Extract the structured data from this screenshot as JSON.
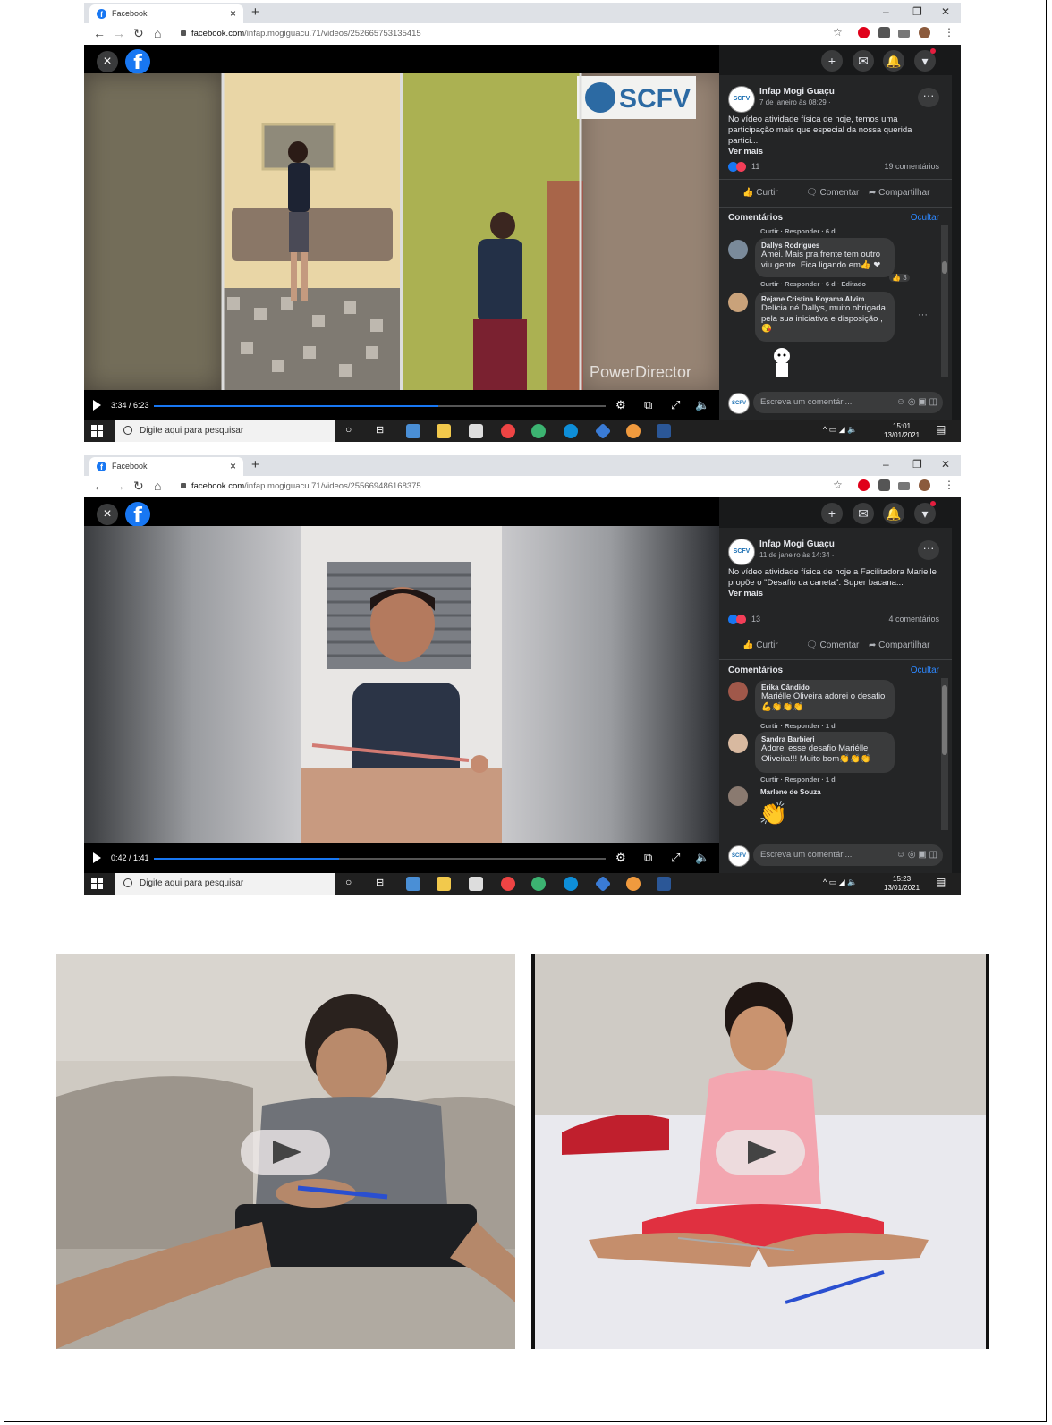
{
  "screens": [
    {
      "tab_title": "Facebook",
      "url_host": "facebook.com",
      "url_path": "/infap.mogiguacu.71/videos/252665753135415",
      "video_time": "3:34 / 6:23",
      "progress": 0.63,
      "post": {
        "page_name": "Infap Mogi Guaçu",
        "date": "7 de janeiro às 08:29 · ",
        "text": "No vídeo atividade física de hoje, temos uma participação mais que especial da nossa querida partici...",
        "see_more": "Ver mais",
        "reactions_count": "11",
        "comments_count": "19 comentários"
      },
      "actions": {
        "like": "Curtir",
        "comment": "Comentar",
        "share": "Compartilhar"
      },
      "comments_header": "Comentários",
      "hide_label": "Ocultar",
      "comments": [
        {
          "meta_only": "Curtir · Responder · 6 d"
        },
        {
          "author": "Dallys Rodrigues",
          "text": "Amei. Mais pra frente tem outro viu gente. Fica ligando em👍 ❤",
          "meta": "Curtir · Responder · 6 d · Editado",
          "badge": "3"
        },
        {
          "author": "Rejane Cristina Koyama Alvim",
          "text": "Delícia né Dallys, muito obrigada pela sua iniciativa e disposição , 😘",
          "meta": ""
        }
      ],
      "composer_placeholder": "Escreva um comentári...",
      "watermark_top": "SCFV",
      "watermark_bottom": "PowerDirector",
      "taskbar": {
        "search": "Digite aqui para pesquisar",
        "time": "15:01",
        "date": "13/01/2021"
      }
    },
    {
      "tab_title": "Facebook",
      "url_host": "facebook.com",
      "url_path": "/infap.mogiguacu.71/videos/255669486168375",
      "video_time": "0:42 / 1:41",
      "progress": 0.41,
      "post": {
        "page_name": "Infap Mogi Guaçu",
        "date": "11 de janeiro às 14:34 · ",
        "text": "No vídeo atividade física de hoje a Facilitadora Marielle propõe o \"Desafio da caneta\". Super bacana...",
        "see_more": "Ver mais",
        "reactions_count": "13",
        "comments_count": "4 comentários"
      },
      "actions": {
        "like": "Curtir",
        "comment": "Comentar",
        "share": "Compartilhar"
      },
      "comments_header": "Comentários",
      "hide_label": "Ocultar",
      "comments": [
        {
          "author": "Erika Cândido",
          "text": "Mariélle Oliveira adorei o desafio 💪👏👏👏",
          "meta": "Curtir · Responder · 1 d"
        },
        {
          "author": "Sandra Barbieri",
          "text": "Adorei esse desafio Mariélle Oliveira!!! Muito bom👏👏👏",
          "meta": "Curtir · Responder · 1 d"
        },
        {
          "author": "Marlene de Souza",
          "text": "👏",
          "meta": ""
        }
      ],
      "composer_placeholder": "Escreva um comentári...",
      "taskbar": {
        "search": "Digite aqui para pesquisar",
        "time": "15:23",
        "date": "13/01/2021"
      }
    }
  ],
  "icons": [
    "facebook-icon",
    "close-icon",
    "plus-icon",
    "messenger-icon",
    "bell-icon",
    "caret-down-icon",
    "play-icon",
    "gear-icon",
    "miniplayer-icon",
    "fullscreen-icon",
    "volume-icon"
  ],
  "colors": {
    "fb_blue": "#1877f2",
    "panel_bg": "#242526",
    "link_blue": "#2d88ff"
  }
}
